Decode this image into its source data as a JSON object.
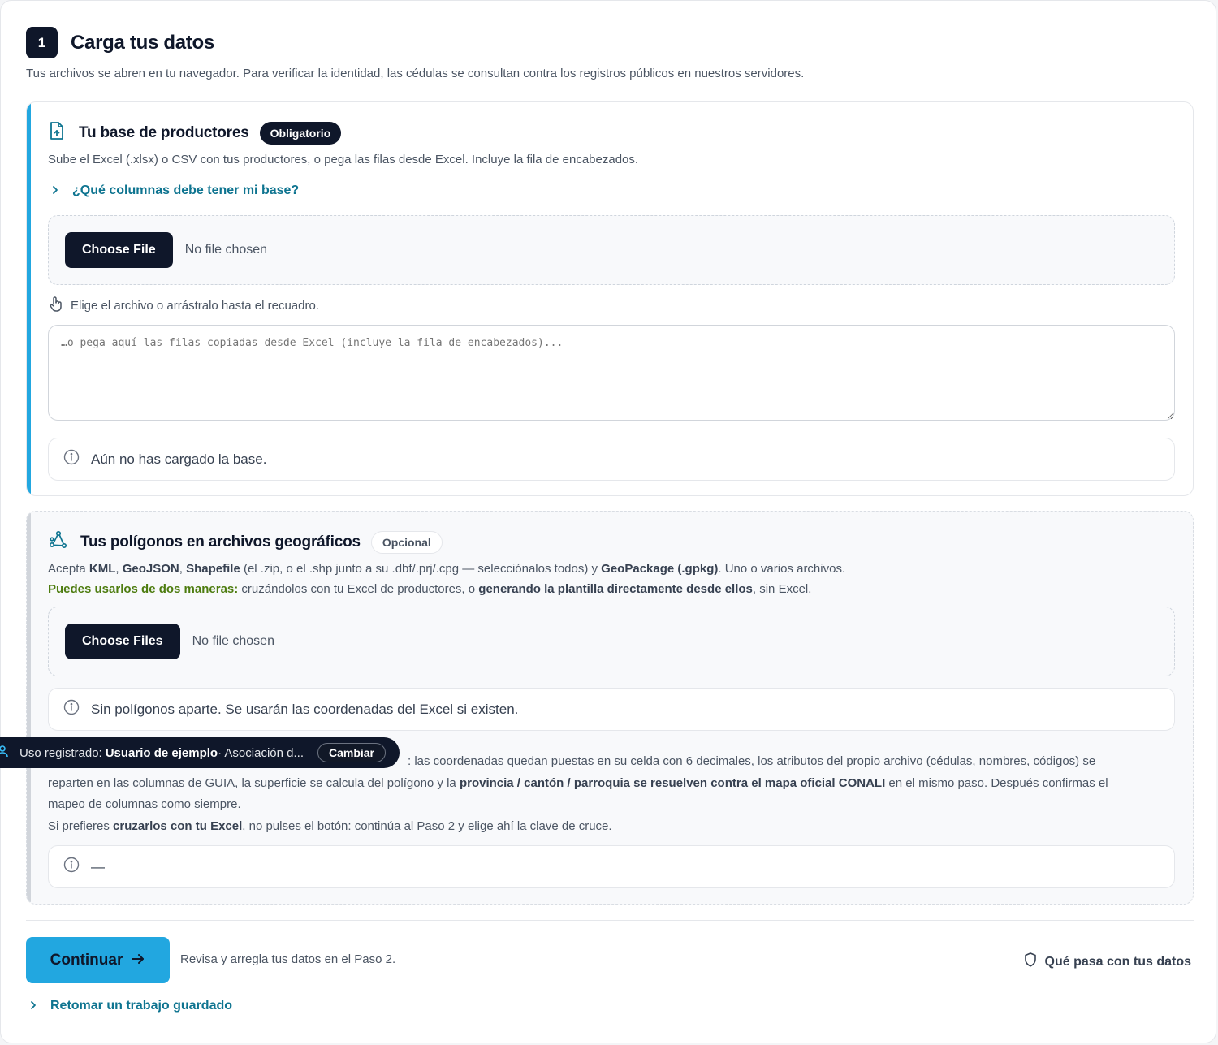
{
  "step": {
    "number": "1",
    "title": "Carga tus datos",
    "subtitle": "Tus archivos se abren en tu navegador. Para verificar la identidad, las cédulas se consultan contra los registros públicos en nuestros servidores."
  },
  "base": {
    "title": "Tu base de productores",
    "badge": "Obligatorio",
    "description": "Sube el Excel (.xlsx) o CSV con tus productores, o pega las filas desde Excel. Incluye la fila de encabezados.",
    "columns_link": "¿Qué columnas debe tener mi base?",
    "file_button": "Choose File",
    "file_status": "No file chosen",
    "hint": "Elige el archivo o arrástralo hasta el recuadro.",
    "paste_placeholder": "…o pega aquí las filas copiadas desde Excel (incluye la fila de encabezados)...",
    "status": "Aún no has cargado la base."
  },
  "polygons": {
    "title": "Tus polígonos en archivos geográficos",
    "badge": "Opcional",
    "accepts": {
      "t1": "Acepta ",
      "kml": "KML",
      "sep1": ", ",
      "geojson": "GeoJSON",
      "sep2": ", ",
      "shapefile": "Shapefile",
      "t2": " (el .zip, o el .shp junto a su .dbf/.prj/.cpg — selecciónalos todos) y ",
      "gpkg": "GeoPackage (.gpkg)",
      "t3": ". Uno o varios archivos."
    },
    "ways": {
      "lead": "Puedes usarlos de dos maneras:",
      "t1": " cruzándolos con tu Excel de productores, o ",
      "bold": "generando la plantilla directamente desde ellos",
      "t2": ", sin Excel."
    },
    "file_button": "Choose Files",
    "file_status": "No file chosen",
    "status": "Sin polígonos aparte. Se usarán las coordenadas del Excel si existen.",
    "explain": {
      "l1": ": las coordenadas quedan puestas en su celda con 6 decimales, los atributos del propio archivo (cédulas, nombres, códigos) se",
      "l2a": "reparten en las columnas de GUIA, la superficie se calcula del polígono y la ",
      "l2b": "provincia / cantón / parroquia se resuelven contra el mapa oficial CONALI",
      "l2c": " en el mismo paso. Después confirmas el",
      "l3": "mapeo de columnas como siempre.",
      "l4a": "Si prefieres ",
      "l4b": "cruzarlos con tu Excel",
      "l4c": ", no pulses el botón: continúa al Paso 2 y elige ahí la clave de cruce."
    },
    "result": "—"
  },
  "footer": {
    "continue_label": "Continuar",
    "continue_arrow": "→",
    "continue_sub": "Revisa y arregla tus datos en el Paso 2.",
    "privacy_link": "Qué pasa con tus datos",
    "resume_link": "Retomar un trabajo guardado"
  },
  "toast": {
    "prefix": "Uso registrado:",
    "user": "Usuario de ejemplo",
    "suffix": " · Asociación d...",
    "change": "Cambiar"
  },
  "colors": {
    "accent": "#22a7e0",
    "dark": "#0f172a",
    "link": "#0e7490",
    "green": "#4d7c0f"
  }
}
